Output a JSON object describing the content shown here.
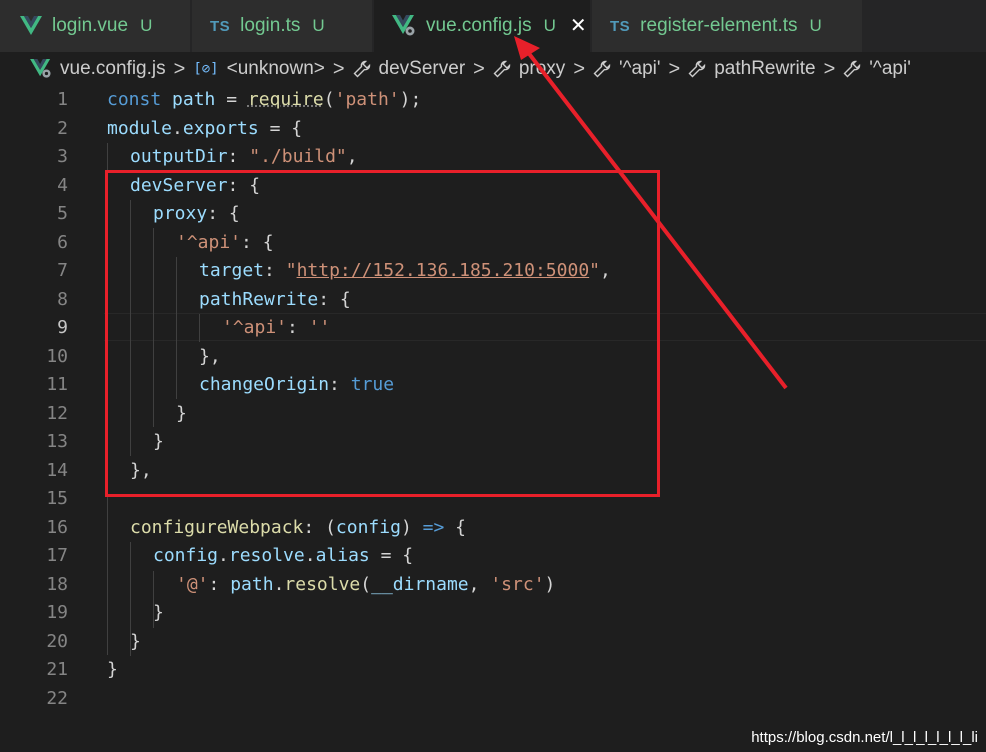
{
  "tabs": [
    {
      "label": "login.vue",
      "badge": "U",
      "icon": "vue-icon",
      "active": false
    },
    {
      "label": "login.ts",
      "badge": "U",
      "icon": "ts-icon",
      "icon_text": "TS",
      "active": false
    },
    {
      "label": "vue.config.js",
      "badge": "U",
      "icon": "vue-config-icon",
      "active": true,
      "close": "✕"
    },
    {
      "label": "register-element.ts",
      "badge": "U",
      "icon": "ts-icon",
      "icon_text": "TS",
      "active": false
    }
  ],
  "breadcrumb": [
    {
      "label": "vue.config.js",
      "icon": "vue-config-icon"
    },
    {
      "label": "<unknown>",
      "icon": "symbol-variable-icon",
      "icon_text": "[⊘]"
    },
    {
      "label": "devServer",
      "icon": "wrench-icon"
    },
    {
      "label": "proxy",
      "icon": "wrench-icon"
    },
    {
      "label": "'^api'",
      "icon": "wrench-icon"
    },
    {
      "label": "pathRewrite",
      "icon": "wrench-icon"
    },
    {
      "label": "'^api'",
      "icon": "wrench-icon"
    }
  ],
  "breadcrumb_separator": ">",
  "editor": {
    "current_line": 9,
    "lines": [
      {
        "n": "1"
      },
      {
        "n": "2"
      },
      {
        "n": "3"
      },
      {
        "n": "4"
      },
      {
        "n": "5"
      },
      {
        "n": "6"
      },
      {
        "n": "7"
      },
      {
        "n": "8"
      },
      {
        "n": "9"
      },
      {
        "n": "10"
      },
      {
        "n": "11"
      },
      {
        "n": "12"
      },
      {
        "n": "13"
      },
      {
        "n": "14"
      },
      {
        "n": "15"
      },
      {
        "n": "16"
      },
      {
        "n": "17"
      },
      {
        "n": "18"
      },
      {
        "n": "19"
      },
      {
        "n": "20"
      },
      {
        "n": "21"
      },
      {
        "n": "22"
      }
    ],
    "code": {
      "l1": {
        "const": "const",
        "path": "path",
        "eq": " = ",
        "require": "require",
        "open": "(",
        "str": "'path'",
        "close": ");"
      },
      "l2": {
        "module": "module",
        "dot": ".",
        "exports": "exports",
        "rest": " = {"
      },
      "l3": {
        "key": "outputDir",
        "colon": ": ",
        "str": "\"./build\"",
        "comma": ","
      },
      "l4": {
        "key": "devServer",
        "rest": ": {"
      },
      "l5": {
        "key": "proxy",
        "rest": ": {"
      },
      "l6": {
        "str": "'^api'",
        "rest": ": {"
      },
      "l7": {
        "key": "target",
        "colon": ": ",
        "q1": "\"",
        "url": "http://152.136.185.210:5000",
        "q2": "\"",
        "comma": ","
      },
      "l8": {
        "key": "pathRewrite",
        "rest": ": {"
      },
      "l9": {
        "str": "'^api'",
        "colon": ": ",
        "val": "''"
      },
      "l10": {
        "rest": "},"
      },
      "l11": {
        "key": "changeOrigin",
        "colon": ": ",
        "val": "true"
      },
      "l12": {
        "rest": "}"
      },
      "l13": {
        "rest": "}"
      },
      "l14": {
        "rest": "},"
      },
      "l16": {
        "key": "configureWebpack",
        "colon": ": (",
        "param": "config",
        "arrow1": ") ",
        "arrow": "=>",
        "rest": " {"
      },
      "l17": {
        "a": "config",
        "d1": ".",
        "b": "resolve",
        "d2": ".",
        "c": "alias",
        "rest": " = {"
      },
      "l18": {
        "str": "'@'",
        "colon": ": ",
        "a": "path",
        "d1": ".",
        "fn": "resolve",
        "open": "(",
        "dir": "__dirname",
        "comma": ", ",
        "str2": "'src'",
        "close": ")"
      },
      "l19": {
        "rest": "}"
      },
      "l20": {
        "rest": "}"
      },
      "l21": {
        "rest": "}"
      }
    }
  },
  "colors": {
    "annotation": "#e8202a",
    "untracked": "#73c991",
    "keyword": "#569cd6",
    "string": "#ce9178",
    "variable": "#9cdcfe",
    "function": "#dcdcaa"
  },
  "watermark": "https://blog.csdn.net/l_l_l_l_l_l_l_li"
}
